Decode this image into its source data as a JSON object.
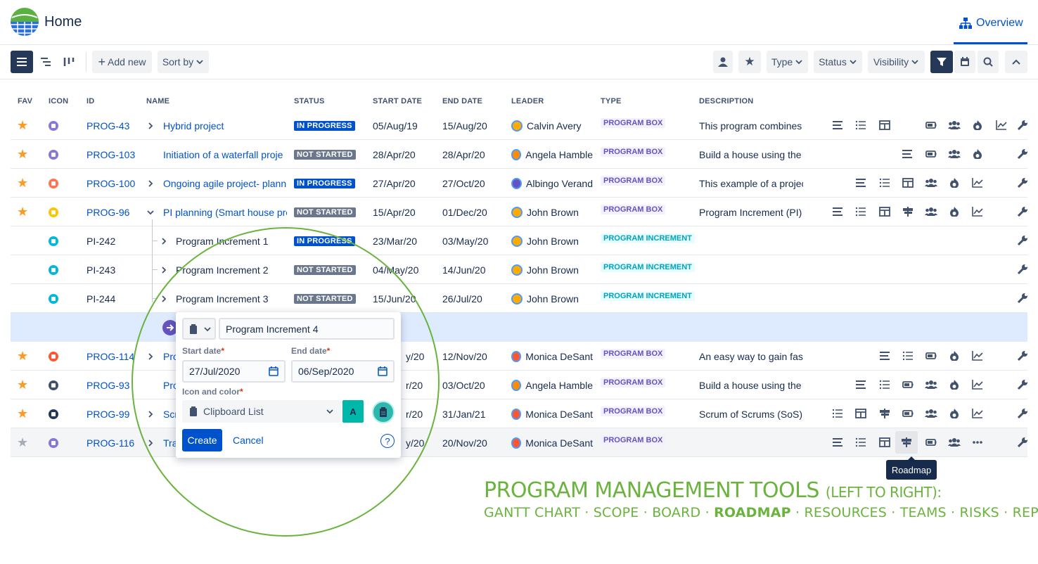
{
  "header": {
    "title": "Home",
    "overview_label": "Overview"
  },
  "toolbar": {
    "add_new": "Add new",
    "sort_by": "Sort by",
    "filters": [
      "Type",
      "Status",
      "Visibility"
    ]
  },
  "table": {
    "columns": [
      "FAV",
      "ICON",
      "ID",
      "NAME",
      "STATUS",
      "START DATE",
      "END DATE",
      "LEADER",
      "TYPE",
      "DESCRIPTION"
    ],
    "rows": [
      {
        "id": "PROG-43",
        "name": "Hybrid project",
        "status": "IN PROGRESS",
        "start": "05/Aug/19",
        "end": "15/Aug/20",
        "leader": "Calvin Avery",
        "type": "PROGRAM BOX",
        "description": "This program combines",
        "fav": true,
        "icon_color": "#8777d9",
        "avatar": "#ffab00"
      },
      {
        "id": "PROG-103",
        "name": "Initiation of a waterfall proje",
        "status": "NOT STARTED",
        "start": "28/Apr/20",
        "end": "28/Apr/20",
        "leader": "Angela Hamble",
        "type": "PROGRAM BOX",
        "description": "Build a house using the",
        "fav": true,
        "icon_color": "#8777d9",
        "avatar": "#ff8b00"
      },
      {
        "id": "PROG-100",
        "name": "Ongoing agile project- planni",
        "status": "IN PROGRESS",
        "start": "27/Apr/20",
        "end": "27/Oct/20",
        "leader": "Albingo Verand",
        "type": "PROGRAM BOX",
        "description": "This example of a projec",
        "fav": true,
        "icon_color": "#ff7452",
        "avatar": "#6554c0"
      },
      {
        "id": "PROG-96",
        "name": "PI planning (Smart house pro",
        "status": "NOT STARTED",
        "start": "15/Apr/20",
        "end": "01/Dec/20",
        "leader": "John Brown",
        "type": "PROGRAM BOX",
        "description": "Program Increment (PI)",
        "fav": true,
        "icon_color": "#ffc400",
        "avatar": "#ffab00"
      },
      {
        "id": "PI-242",
        "name": "Program Increment 1",
        "status": "IN PROGRESS",
        "start": "23/Mar/20",
        "end": "03/May/20",
        "leader": "John Brown",
        "type": "PROGRAM INCREMENT",
        "description": "",
        "fav": false,
        "icon_color": "#00b8d9",
        "avatar": "#ffab00"
      },
      {
        "id": "PI-243",
        "name": "Program Increment 2",
        "status": "NOT STARTED",
        "start": "04/May/20",
        "end": "14/Jun/20",
        "leader": "John Brown",
        "type": "PROGRAM INCREMENT",
        "description": "",
        "fav": false,
        "icon_color": "#00b8d9",
        "avatar": "#ffab00"
      },
      {
        "id": "PI-244",
        "name": "Program Increment 3",
        "status": "NOT STARTED",
        "start": "15/Jun/20",
        "end": "26/Jul/20",
        "leader": "John Brown",
        "type": "PROGRAM INCREMENT",
        "description": "",
        "fav": false,
        "icon_color": "#00b8d9",
        "avatar": "#ffab00"
      },
      {
        "id": "PROG-114",
        "name": "Pro",
        "status": "",
        "start": "y/20",
        "end": "12/Nov/20",
        "leader": "Monica DeSant",
        "type": "PROGRAM BOX",
        "description": "An easy way to gain fas",
        "fav": true,
        "icon_color": "#ff5630",
        "avatar": "#ff5630"
      },
      {
        "id": "PROG-93",
        "name": "Pro",
        "status": "",
        "start": "r/20",
        "end": "03/Oct/20",
        "leader": "Angela Hamble",
        "type": "PROGRAM BOX",
        "description": "Build a house using the",
        "fav": true,
        "icon_color": "#42526e",
        "avatar": "#ff8b00"
      },
      {
        "id": "PROG-99",
        "name": "Scr",
        "status": "",
        "start": "r/20",
        "end": "31/Jan/21",
        "leader": "Monica DeSant",
        "type": "PROGRAM BOX",
        "description": "Scrum of Scrums (SoS)",
        "fav": true,
        "icon_color": "#253858",
        "avatar": "#ff5630"
      },
      {
        "id": "PROG-116",
        "name": "Tra",
        "status": "",
        "start": "y/20",
        "end": "20/Nov/20",
        "leader": "Monica DeSant",
        "type": "PROGRAM BOX",
        "description": "",
        "fav": false,
        "icon_color": "#8777d9",
        "avatar": "#ff5630"
      }
    ]
  },
  "popup": {
    "name_value": "Program Increment 4",
    "start_label": "Start date",
    "end_label": "End date",
    "start_value": "27/Jul/2020",
    "end_value": "06/Sep/2020",
    "icon_label": "Icon and color",
    "icon_value": "Clipboard List",
    "color_letter": "A",
    "create": "Create",
    "cancel": "Cancel"
  },
  "tooltip": "Roadmap",
  "caption": {
    "title": "PROGRAM MANAGEMENT TOOLS",
    "subtitle": "(LEFT TO RIGHT):",
    "tools": "GANTT CHART · SCOPE · BOARD · ",
    "highlight": "ROADMAP",
    "tools_rest": " · RESOURCES · TEAMS · RISKS · REPORTS"
  },
  "colors": {
    "accent": "#0052cc",
    "green": "#6ab43e",
    "star": "#ff991f"
  }
}
